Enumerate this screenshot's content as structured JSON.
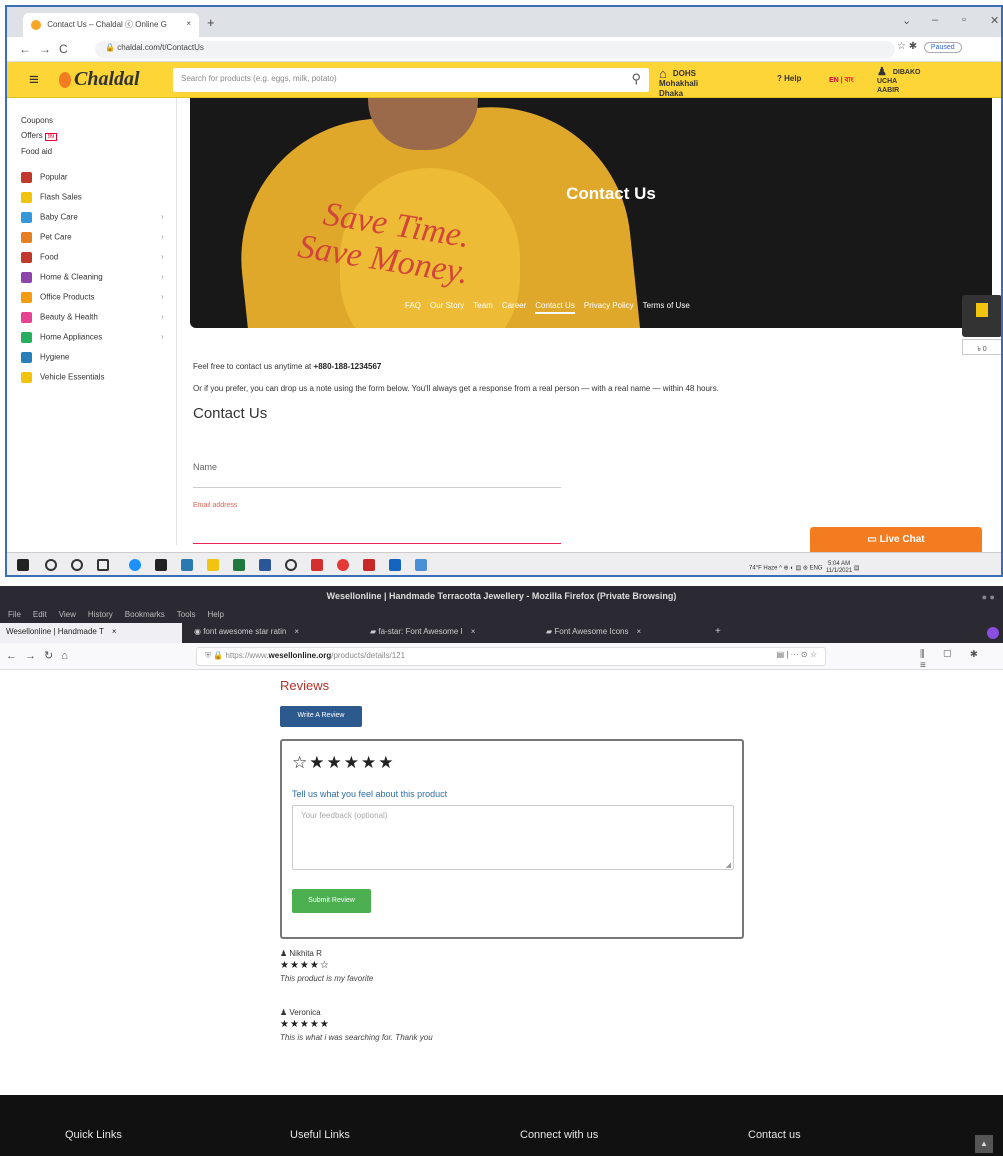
{
  "window1": {
    "tab_title": "Contact Us – Chaldal ⓒ Online G",
    "tab_close": "×",
    "new_tab": "+",
    "url": "chaldal.com/t/ContactUs",
    "paused_label": "Paused",
    "header": {
      "logo": "Chaldal",
      "search_placeholder": "Search for products (e.g. eggs, milk, potato)",
      "location_line1": "DOHS Mohakhali",
      "location_line2": "Dhaka",
      "help": "? Help",
      "language": "EN | বাং",
      "user_line1": "DIBAKO UCHA",
      "user_line2": "AABIR"
    },
    "sidebar": {
      "links": [
        {
          "label": "Coupons"
        },
        {
          "label": "Offers",
          "badge": "99"
        },
        {
          "label": "Food aid"
        }
      ],
      "categories": [
        {
          "label": "Popular",
          "color": "#c0392b",
          "has_chevron": false
        },
        {
          "label": "Flash Sales",
          "color": "#f1c40f",
          "has_chevron": false
        },
        {
          "label": "Baby Care",
          "color": "#3498db",
          "has_chevron": true
        },
        {
          "label": "Pet Care",
          "color": "#e67e22",
          "has_chevron": true
        },
        {
          "label": "Food",
          "color": "#c0392b",
          "has_chevron": true
        },
        {
          "label": "Home & Cleaning",
          "color": "#8e44ad",
          "has_chevron": true
        },
        {
          "label": "Office Products",
          "color": "#f39c12",
          "has_chevron": true
        },
        {
          "label": "Beauty & Health",
          "color": "#e84393",
          "has_chevron": true
        },
        {
          "label": "Home Appliances",
          "color": "#27ae60",
          "has_chevron": true
        },
        {
          "label": "Hygiene",
          "color": "#2980b9",
          "has_chevron": false
        },
        {
          "label": "Vehicle Essentials",
          "color": "#f1c40f",
          "has_chevron": false
        }
      ]
    },
    "hero": {
      "title": "Contact Us",
      "slogan_line1": "Save Time.",
      "slogan_line2": "Save Money.",
      "nav": [
        "FAQ",
        "Our Story",
        "Team",
        "Career",
        "Contact Us",
        "Privacy Policy",
        "Terms of Use"
      ],
      "active_nav": "Contact Us"
    },
    "contact": {
      "line1_prefix": "Feel free to contact us anytime at",
      "phone": "+880-188-1234567",
      "line2": "Or if you prefer, you can drop us a note using the form below. You'll always get a response from a real person — with a real name — within 48 hours.",
      "form_title": "Contact Us",
      "name_placeholder": "Name",
      "email_placeholder": "Email address"
    },
    "live_chat": "Live Chat",
    "taskbar": {
      "tray_text": "74°F Haze  ^  ⊕ ◐ ▤ ⊛ ENG",
      "time": "5:04 AM",
      "date": "11/1/2021"
    }
  },
  "window2": {
    "title": "Wesellonline | Handmade Terracotta Jewellery - Mozilla Firefox (Private Browsing)",
    "menu": [
      "File",
      "Edit",
      "View",
      "History",
      "Bookmarks",
      "Tools",
      "Help"
    ],
    "tabs": [
      {
        "label": "Wesellonline | Handmade T"
      },
      {
        "label": "font awesome star ratin"
      },
      {
        "label": "fa-star: Font Awesome I"
      },
      {
        "label": "Font Awesome Icons"
      }
    ],
    "tab_close": "×",
    "new_tab": "+",
    "url_prefix": "https://www.",
    "url_domain": "wesellonline.org",
    "url_path": "/products/details/121",
    "reviews_title": "Reviews",
    "write_review": "Write A Review",
    "rating_stars": "☆★★★★★",
    "feel_label": "Tell us what you feel about this product",
    "feedback_placeholder": "Your feedback (optional)",
    "submit": "Submit Review",
    "reviews": [
      {
        "user": "Nikhita R",
        "stars": "★★★★☆",
        "comment": "This product is my favorite"
      },
      {
        "user": "Veronica",
        "stars": "★★★★★",
        "comment": "This is what i was searching for. Thank you"
      }
    ],
    "footer": [
      "Quick Links",
      "Useful Links",
      "Connect with us",
      "Contact us"
    ]
  }
}
